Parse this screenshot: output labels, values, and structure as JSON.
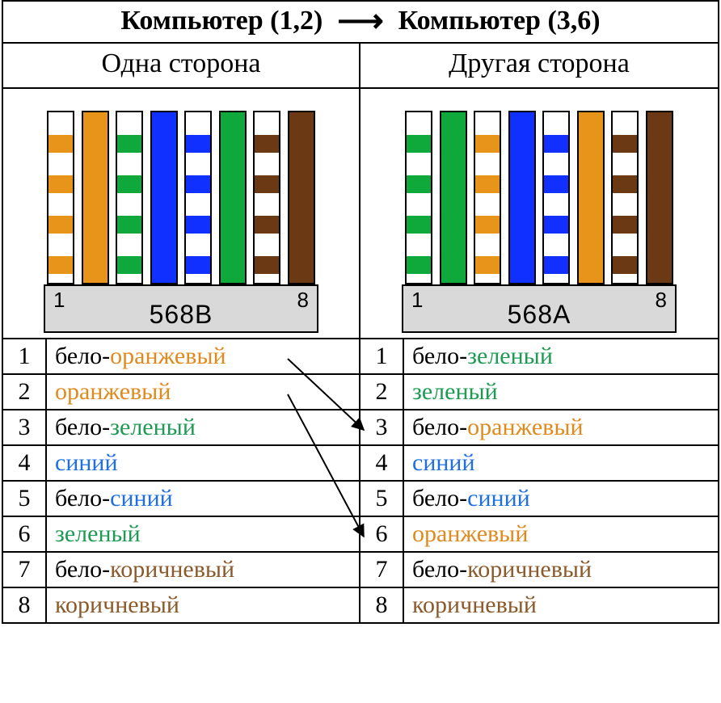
{
  "title": {
    "from": "Компьютер (1,2)",
    "to": "Компьютер (3,6)"
  },
  "colors": {
    "orange": "#e8941a",
    "green": "#0fa83a",
    "blue": "#1030ff",
    "brown": "#6b3a14",
    "white": "#ffffff"
  },
  "left": {
    "side_title": "Одна сторона",
    "standard": "568B",
    "pin_start": "1",
    "pin_end": "8",
    "wires": [
      {
        "num": "1",
        "parts": [
          {
            "t": "бело-",
            "c": ""
          },
          {
            "t": "оранжевый",
            "c": "c-orange"
          }
        ],
        "stripe": "orange"
      },
      {
        "num": "2",
        "parts": [
          {
            "t": "оранжевый",
            "c": "c-orange"
          }
        ],
        "solid": "orange"
      },
      {
        "num": "3",
        "parts": [
          {
            "t": "бело-",
            "c": ""
          },
          {
            "t": "зеленый",
            "c": "c-green"
          }
        ],
        "stripe": "green"
      },
      {
        "num": "4",
        "parts": [
          {
            "t": "синий",
            "c": "c-blue"
          }
        ],
        "solid": "blue"
      },
      {
        "num": "5",
        "parts": [
          {
            "t": "бело-",
            "c": ""
          },
          {
            "t": "синий",
            "c": "c-blue"
          }
        ],
        "stripe": "blue"
      },
      {
        "num": "6",
        "parts": [
          {
            "t": "зеленый",
            "c": "c-green"
          }
        ],
        "solid": "green"
      },
      {
        "num": "7",
        "parts": [
          {
            "t": "бело-",
            "c": ""
          },
          {
            "t": "коричневый",
            "c": "c-brown"
          }
        ],
        "stripe": "brown"
      },
      {
        "num": "8",
        "parts": [
          {
            "t": "коричневый",
            "c": "c-brown"
          }
        ],
        "solid": "brown"
      }
    ]
  },
  "right": {
    "side_title": "Другая сторона",
    "standard": "568A",
    "pin_start": "1",
    "pin_end": "8",
    "wires": [
      {
        "num": "1",
        "parts": [
          {
            "t": "бело-",
            "c": ""
          },
          {
            "t": "зеленый",
            "c": "c-green"
          }
        ],
        "stripe": "green"
      },
      {
        "num": "2",
        "parts": [
          {
            "t": "зеленый",
            "c": "c-green"
          }
        ],
        "solid": "green"
      },
      {
        "num": "3",
        "parts": [
          {
            "t": "бело-",
            "c": ""
          },
          {
            "t": "оранжевый",
            "c": "c-orange"
          }
        ],
        "stripe": "orange"
      },
      {
        "num": "4",
        "parts": [
          {
            "t": "синий",
            "c": "c-blue"
          }
        ],
        "solid": "blue"
      },
      {
        "num": "5",
        "parts": [
          {
            "t": "бело-",
            "c": ""
          },
          {
            "t": "синий",
            "c": "c-blue"
          }
        ],
        "stripe": "blue"
      },
      {
        "num": "6",
        "parts": [
          {
            "t": "оранжевый",
            "c": "c-orange"
          }
        ],
        "solid": "orange"
      },
      {
        "num": "7",
        "parts": [
          {
            "t": "бело-",
            "c": ""
          },
          {
            "t": "коричневый",
            "c": "c-brown"
          }
        ],
        "stripe": "brown"
      },
      {
        "num": "8",
        "parts": [
          {
            "t": "коричневый",
            "c": "c-brown"
          }
        ],
        "solid": "brown"
      }
    ]
  },
  "crossover": [
    {
      "from_row": 1,
      "to_row": 3
    },
    {
      "from_row": 2,
      "to_row": 6
    }
  ]
}
